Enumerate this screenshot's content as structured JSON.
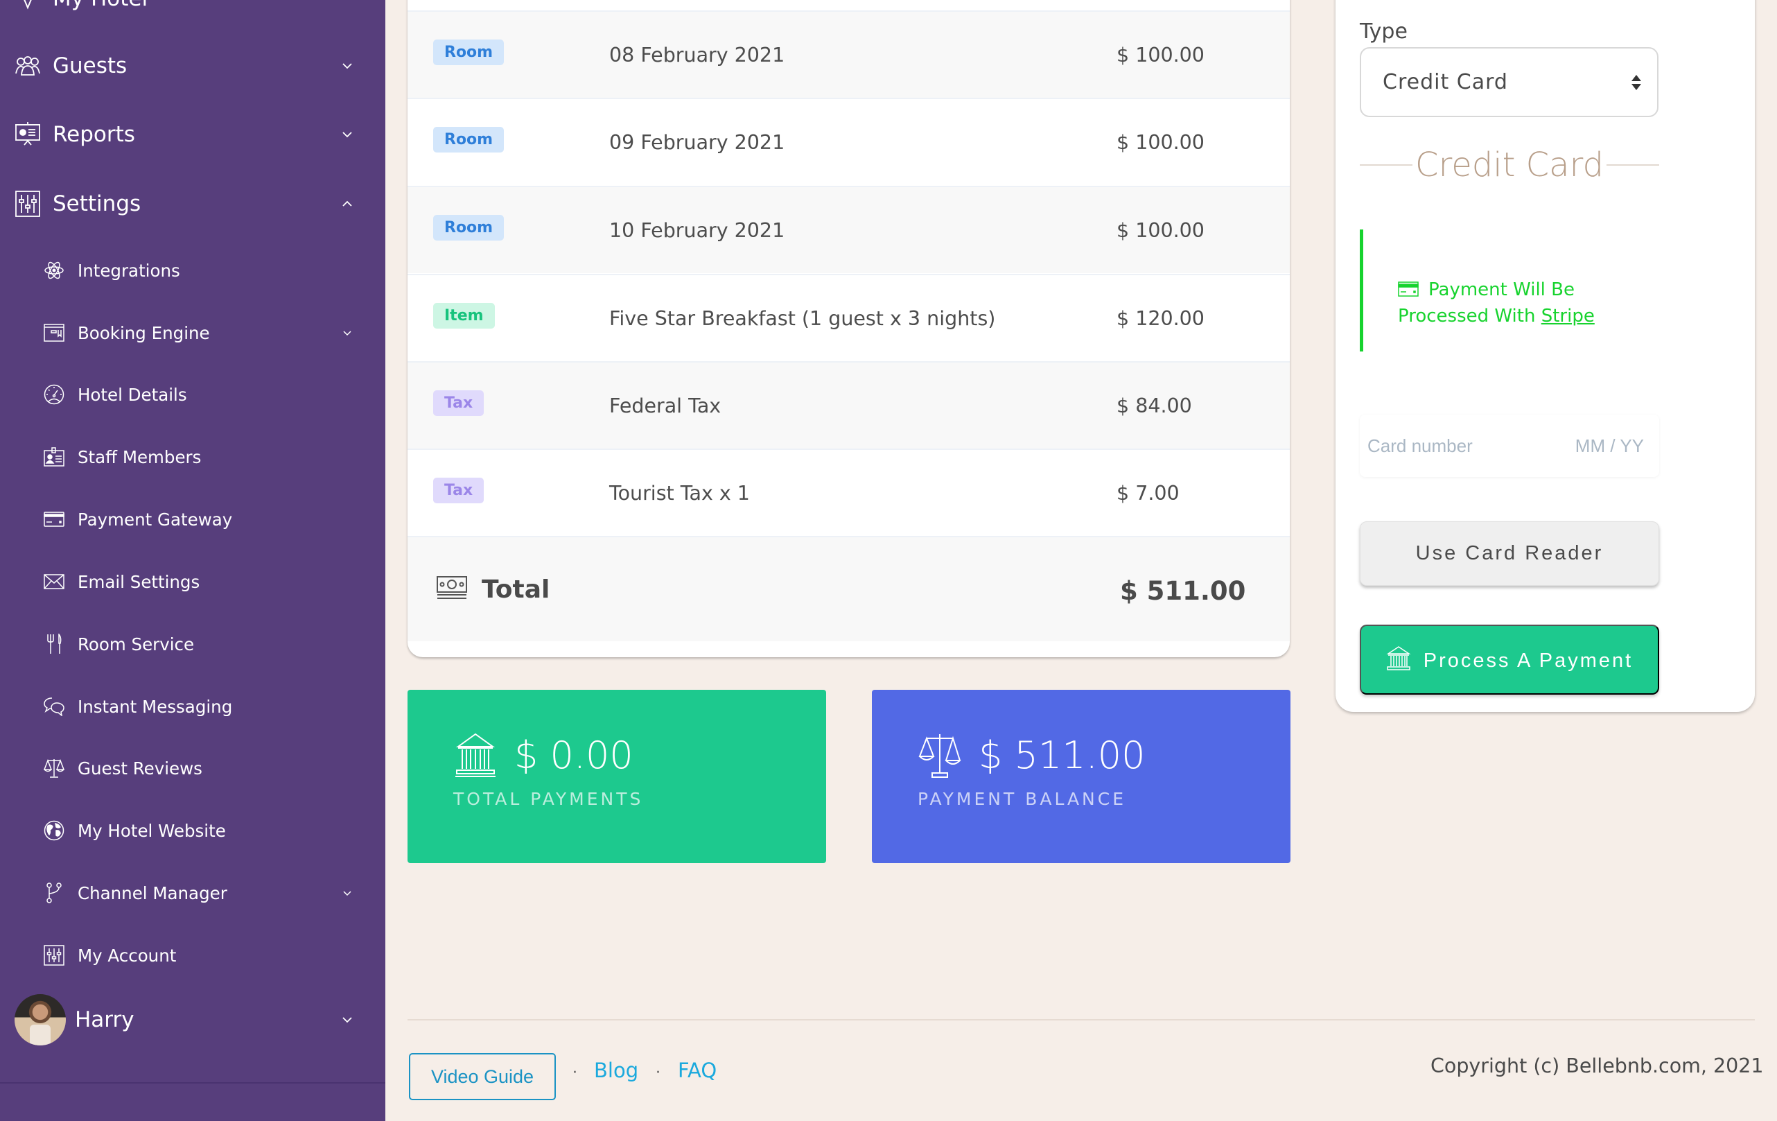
{
  "sidebar": {
    "partial_top_label": "My Hotel",
    "top_items": [
      {
        "label": "Guests",
        "icon": "guests-icon",
        "expanded": false
      },
      {
        "label": "Reports",
        "icon": "presentation-icon",
        "expanded": false
      },
      {
        "label": "Settings",
        "icon": "sliders-icon",
        "expanded": true
      }
    ],
    "settings_items": [
      {
        "label": "Integrations",
        "icon": "atom-icon",
        "has_submenu": false
      },
      {
        "label": "Booking Engine",
        "icon": "browser-window-icon",
        "has_submenu": true
      },
      {
        "label": "Hotel Details",
        "icon": "speedometer-icon",
        "has_submenu": false
      },
      {
        "label": "Staff Members",
        "icon": "id-badge-icon",
        "has_submenu": false
      },
      {
        "label": "Payment Gateway",
        "icon": "credit-card-icon",
        "has_submenu": false
      },
      {
        "label": "Email Settings",
        "icon": "envelope-icon",
        "has_submenu": false
      },
      {
        "label": "Room Service",
        "icon": "fork-knife-icon",
        "has_submenu": false
      },
      {
        "label": "Instant Messaging",
        "icon": "chat-bubbles-icon",
        "has_submenu": false
      },
      {
        "label": "Guest Reviews",
        "icon": "scales-icon",
        "has_submenu": false
      },
      {
        "label": "My Hotel Website",
        "icon": "globe-icon",
        "has_submenu": false
      },
      {
        "label": "Channel Manager",
        "icon": "branch-icon",
        "has_submenu": true
      },
      {
        "label": "My Account",
        "icon": "sliders-icon",
        "has_submenu": false
      }
    ],
    "user": {
      "name": "Harry"
    }
  },
  "invoice": {
    "rows": [
      {
        "type": "Room",
        "description": "08 February 2021",
        "amount": "$ 100.00"
      },
      {
        "type": "Room",
        "description": "09 February 2021",
        "amount": "$ 100.00"
      },
      {
        "type": "Room",
        "description": "10 February 2021",
        "amount": "$ 100.00"
      },
      {
        "type": "Item",
        "description": "Five Star Breakfast (1 guest x 3 nights)",
        "amount": "$ 120.00"
      },
      {
        "type": "Tax",
        "description": "Federal Tax",
        "amount": "$ 84.00"
      },
      {
        "type": "Tax",
        "description": "Tourist Tax x 1",
        "amount": "$ 7.00"
      }
    ],
    "total_label": "Total",
    "total_amount": "$ 511.00"
  },
  "summary": {
    "total_payments": {
      "value": "$ 0.00",
      "label": "TOTAL PAYMENTS"
    },
    "payment_balance": {
      "value": "$ 511.00",
      "label": "PAYMENT BALANCE"
    }
  },
  "payment_panel": {
    "type_label": "Type",
    "type_value": "Credit Card",
    "section_title": "Credit Card",
    "notice_text": "Payment Will Be Processed With ",
    "notice_link": "Stripe",
    "card_number_placeholder": "Card number",
    "expiry_placeholder": "MM / YY",
    "card_reader_button": "Use Card Reader",
    "process_button": "Process A Payment"
  },
  "footer": {
    "video_guide": "Video Guide",
    "separator": "·",
    "blog": "Blog",
    "faq": "FAQ",
    "copyright": "Copyright (c) Bellebnb.com, 2021"
  },
  "colors": {
    "sidebar": "#573e7c",
    "background": "#f6eee8",
    "green": "#1dc98e",
    "blue": "#5269e5",
    "stripe_notice": "#17d32e",
    "link": "#1ba9dd"
  }
}
